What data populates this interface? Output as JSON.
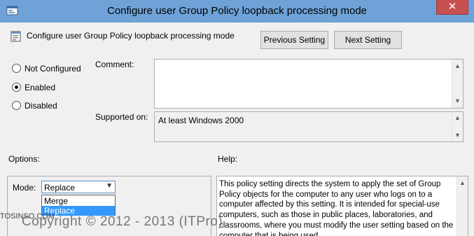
{
  "window": {
    "title": "Configure user Group Policy loopback processing mode",
    "close_glyph": "✕"
  },
  "header": {
    "setting_title": "Configure user Group Policy loopback processing mode",
    "previous_label": "Previous Setting",
    "next_label": "Next Setting"
  },
  "state": {
    "options": [
      {
        "label": "Not Configured",
        "checked": false
      },
      {
        "label": "Enabled",
        "checked": true
      },
      {
        "label": "Disabled",
        "checked": false
      }
    ]
  },
  "comment": {
    "label": "Comment:",
    "value": ""
  },
  "supported": {
    "label": "Supported on:",
    "value": "At least Windows 2000"
  },
  "options_section": {
    "label": "Options:",
    "mode_label": "Mode:",
    "mode_value": "Replace",
    "dropdown_items": [
      "Merge",
      "Replace"
    ],
    "selected_index": 1
  },
  "help": {
    "label": "Help:",
    "text": "This policy setting directs the system to apply the set of Group Policy objects for the computer to any user who logs on to a computer affected by this setting. It is intended for special-use computers, such as those in public places, laboratories, and classrooms, where you must modify the user setting based on the computer that is being used."
  },
  "watermark": {
    "site": "TOSINSO.COM",
    "copyright": "Copyright © 2012 - 2013 (ITPro)"
  },
  "colors": {
    "titlebar": "#6fa3d8",
    "close": "#c75050",
    "selection": "#3399ff"
  },
  "icons": [
    "policy-icon",
    "setting-icon",
    "close-icon",
    "chevron-down-icon",
    "scroll-up-icon",
    "scroll-down-icon"
  ]
}
